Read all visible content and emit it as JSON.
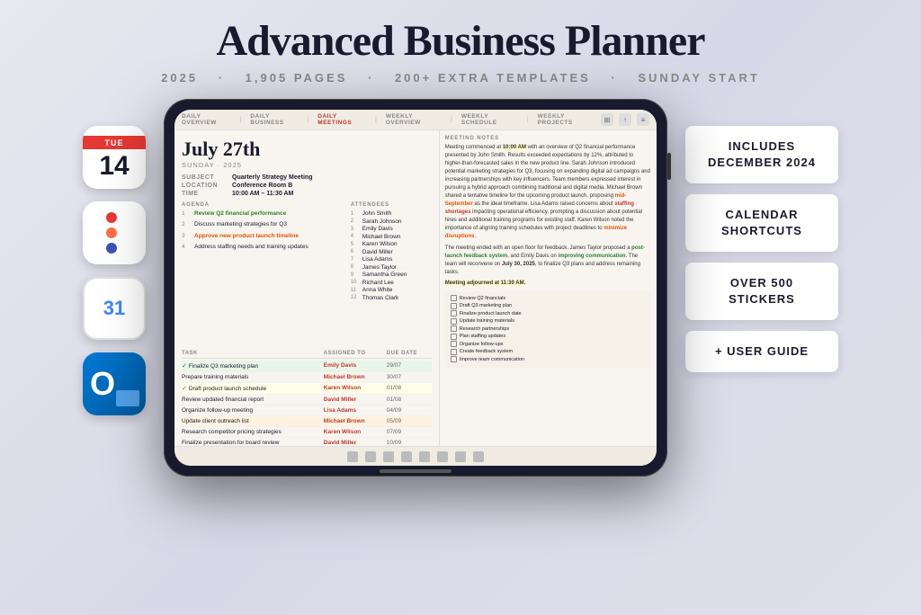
{
  "header": {
    "title": "Advanced Business Planner",
    "subtitle_year": "2025",
    "subtitle_pages": "1,905 PAGES",
    "subtitle_templates": "200+ EXTRA TEMPLATES",
    "subtitle_start": "SUNDAY START"
  },
  "nav": {
    "items": [
      {
        "label": "DAILY OVERVIEW",
        "active": false
      },
      {
        "label": "DAILY BUSINESS",
        "active": false
      },
      {
        "label": "DAILY MEETINGS",
        "active": true
      },
      {
        "label": "WEEKLY OVERVIEW",
        "active": false
      },
      {
        "label": "WEEKLY SCHEDULE",
        "active": false
      },
      {
        "label": "WEEKLY PROJECTS",
        "active": false
      }
    ]
  },
  "date": {
    "heading": "July 27th",
    "sub": "SUNDAY · 2025"
  },
  "meeting": {
    "subject_label": "SUBJECT",
    "subject_val": "Quarterly Strategy Meeting",
    "location_label": "LOCATION",
    "location_val": "Conference Room B",
    "time_label": "TIME",
    "time_val": "10:00 AM – 11:30 AM"
  },
  "attendees": {
    "header": "ATTENDEES",
    "list": [
      {
        "num": "1",
        "name": "John Smith"
      },
      {
        "num": "2",
        "name": "Sarah Johnson"
      },
      {
        "num": "3",
        "name": "Emily Davis"
      },
      {
        "num": "4",
        "name": "Michael Brown"
      },
      {
        "num": "5",
        "name": "Karen Wilson"
      },
      {
        "num": "6",
        "name": "David Miller"
      },
      {
        "num": "7",
        "name": "Lisa Adams"
      },
      {
        "num": "8",
        "name": "James Taylor"
      },
      {
        "num": "9",
        "name": "Samantha Green"
      },
      {
        "num": "10",
        "name": "Richard Lee"
      },
      {
        "num": "11",
        "name": "Anna White"
      },
      {
        "num": "12",
        "name": "Thomas Clark"
      }
    ]
  },
  "agenda": {
    "header": "AGENDA",
    "items": [
      {
        "num": "1",
        "text": "Review Q2 financial performance",
        "style": "green"
      },
      {
        "num": "2",
        "text": "Discuss marketing strategies for Q3",
        "style": "normal"
      },
      {
        "num": "3",
        "text": "Approve new product launch timeline",
        "style": "orange"
      },
      {
        "num": "4",
        "text": "Address staffing needs and training updates",
        "style": "normal"
      }
    ]
  },
  "tasks": {
    "headers": [
      "TASK",
      "ASSIGNED TO",
      "DUE DATE"
    ],
    "rows": [
      {
        "name": "Finalize Q3 marketing plan",
        "checked": true,
        "assignee": "Emily Davis",
        "due": "29/07",
        "style": "green"
      },
      {
        "name": "Prepare training materials",
        "checked": false,
        "assignee": "Michael Brown",
        "due": "30/07",
        "style": ""
      },
      {
        "name": "Draft product launch schedule",
        "checked": true,
        "assignee": "Karen Wilson",
        "due": "01/08",
        "style": "yellow"
      },
      {
        "name": "Review updated financial report",
        "checked": false,
        "assignee": "David Miller",
        "due": "01/08",
        "style": ""
      },
      {
        "name": "Organize follow-up meeting",
        "checked": false,
        "assignee": "Lisa Adams",
        "due": "04/09",
        "style": ""
      },
      {
        "name": "Update client outreach list",
        "checked": false,
        "assignee": "Michael Brown",
        "due": "05/09",
        "style": "orange"
      },
      {
        "name": "Research competitor pricing strategies",
        "checked": false,
        "assignee": "Karen Wilson",
        "due": "07/09",
        "style": ""
      },
      {
        "name": "Finalize presentation for board review",
        "checked": false,
        "assignee": "David Miller",
        "due": "10/09",
        "style": ""
      }
    ]
  },
  "notes": {
    "header": "MEETING NOTES",
    "paragraph1": "Meeting commenced at 10:00 AM with an overview of Q2 financial performance presented by John Smith. Results exceeded expectations by 12%, attributed to higher-than-forecasted sales in the new product line. Sarah Johnson introduced potential marketing strategies for Q3, focusing on expanding digital ad campaigns and increasing partnerships with key influencers. Team members expressed interest in pursuing a hybrid approach combining traditional and digital media. Michael Brown shared a tentative timeline for the upcoming product launch, proposing mid-September as the ideal timeframe. Lisa Adams raised concerns about staffing shortages impacting operational efficiency, prompting a discussion about potential hires and additional training programs for existing staff. Karen Wilson noted the importance of aligning training schedules with project deadlines to minimize disruptions.",
    "paragraph2": "The meeting ended with an open floor for feedback. James Taylor proposed a post-launch feedback system, and Emily Davis on improving communication. The team will reconvene on July 30, 2025, to finalize Q3 plans and address remaining tasks.",
    "closing": "Meeting adjourned at 11:30 AM."
  },
  "checklist": {
    "items": [
      "Review Q2 financials",
      "Draft Q3 marketing plan",
      "Finalize product launch date",
      "Update training materials",
      "Research partnerships",
      "Plan staffing updates",
      "Organize follow-ups",
      "Create feedback system",
      "Improve team communication"
    ]
  },
  "badges": [
    {
      "text": "INCLUDES DECEMBER 2024"
    },
    {
      "text": "CALENDAR SHORTCUTS"
    },
    {
      "text": "OVER 500 STICKERS"
    },
    {
      "text": "+ USER GUIDE"
    }
  ],
  "left_apps": [
    {
      "name": "calendar-app",
      "type": "calendar",
      "day": "TUE",
      "date": "14"
    },
    {
      "name": "reminders-app",
      "type": "reminders"
    },
    {
      "name": "gcal-app",
      "type": "gcal",
      "num": "31"
    },
    {
      "name": "outlook-app",
      "type": "outlook"
    }
  ],
  "colors": {
    "accent_red": "#c0392b",
    "accent_green": "#2e7d32",
    "accent_orange": "#e65100",
    "bg": "#e8e8f0",
    "ipad_frame": "#1a1a2e"
  }
}
